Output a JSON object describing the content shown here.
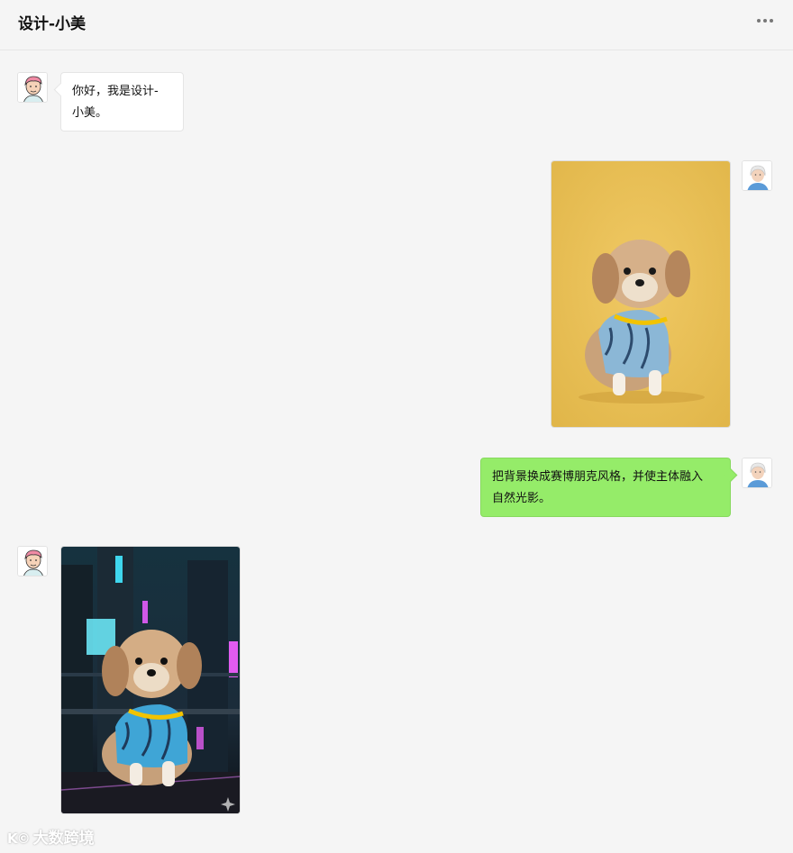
{
  "header": {
    "title": "设计-小美",
    "more_icon": "more-horizontal-icon"
  },
  "messages": [
    {
      "side": "left",
      "type": "text",
      "line1": "你好，我是设计-",
      "line2": "小美。"
    },
    {
      "side": "right",
      "type": "image",
      "description_icon": "dog-photo-yellow-background"
    },
    {
      "side": "right",
      "type": "text",
      "line1": "把背景换成赛博朋克风格，并使主体融入",
      "line2": "自然光影。"
    },
    {
      "side": "left",
      "type": "image",
      "description_icon": "dog-photo-cyberpunk-background"
    }
  ],
  "watermark": {
    "logo": "K©",
    "text": "大数跨境"
  },
  "colors": {
    "bg": "#f5f5f5",
    "user_bubble": "#95ec69",
    "bot_bubble": "#ffffff"
  }
}
